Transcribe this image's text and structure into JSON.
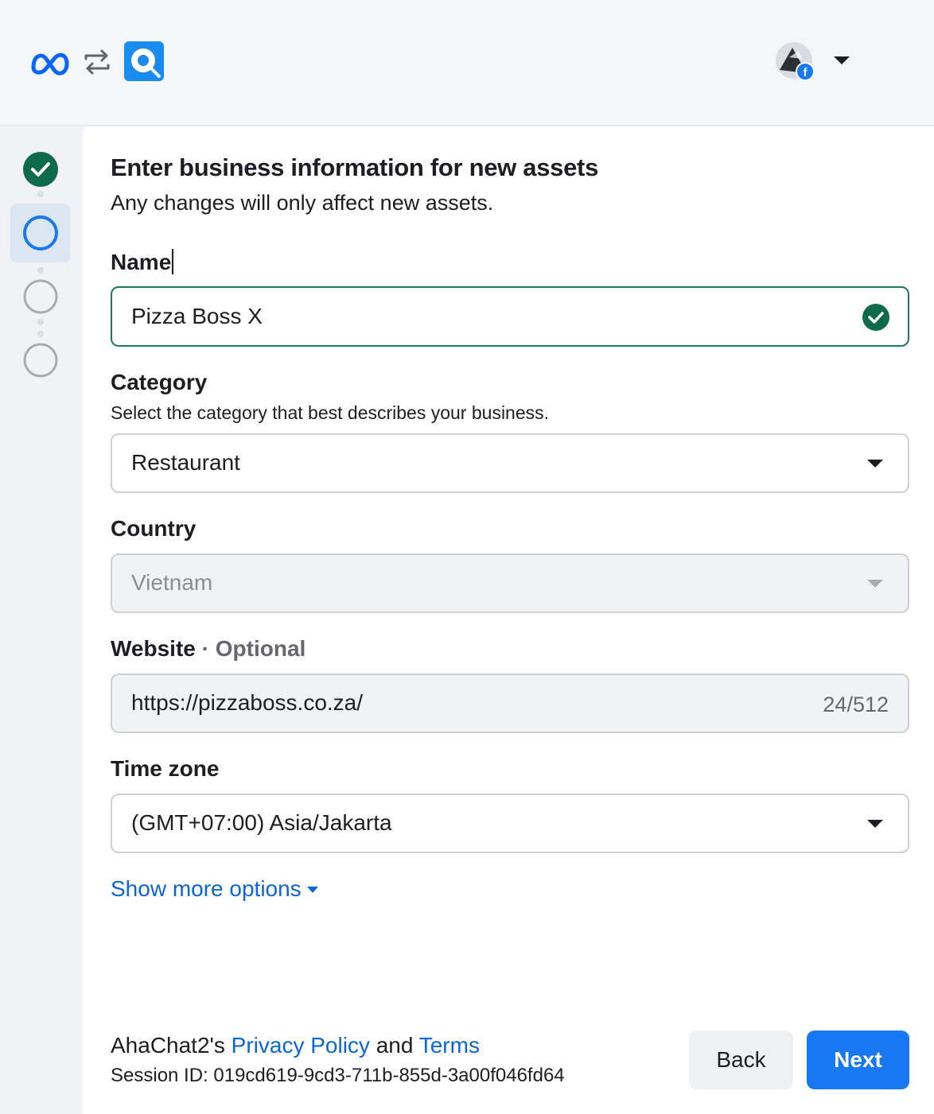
{
  "header": {
    "meta_logo_icon": "meta-infinity-logo",
    "swap_icon": "swap-arrows-icon",
    "app_logo_icon": "ahachat-logo",
    "avatar_badge": "facebook-badge-icon",
    "dropdown_icon": "caret-down-icon"
  },
  "steps": [
    {
      "state": "complete"
    },
    {
      "state": "active"
    },
    {
      "state": "pending"
    },
    {
      "state": "pending"
    }
  ],
  "form": {
    "title": "Enter business information for new assets",
    "subtitle": "Any changes will only affect new assets.",
    "name": {
      "label": "Name",
      "value": "Pizza Boss X",
      "status": "valid"
    },
    "category": {
      "label": "Category",
      "help": "Select the category that best describes your business.",
      "value": "Restaurant"
    },
    "country": {
      "label": "Country",
      "value": "Vietnam",
      "disabled": true
    },
    "website": {
      "label": "Website",
      "optional": "· Optional",
      "value": "https://pizzaboss.co.za/",
      "counter": "24/512"
    },
    "timezone": {
      "label": "Time zone",
      "value": "(GMT+07:00) Asia/Jakarta"
    },
    "show_more": "Show more options"
  },
  "footer": {
    "prefix": "AhaChat2's ",
    "privacy": "Privacy Policy",
    "and": " and ",
    "terms": "Terms",
    "session": "Session ID: 019cd619-9cd3-711b-855d-3a00f046fd64",
    "back_label": "Back",
    "next_label": "Next"
  },
  "colors": {
    "accent": "#1877f2",
    "link": "#0a66d6",
    "success": "#0d7a55",
    "active_step": "#1877f2"
  }
}
